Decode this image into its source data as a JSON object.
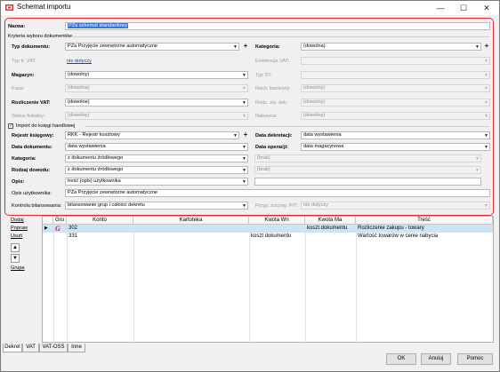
{
  "window": {
    "title": "Schemat importu",
    "icon": "app-icon",
    "controls": {
      "minimize": "—",
      "maximize": "☐",
      "close": "✕"
    }
  },
  "form": {
    "name_label": "Nazwa:",
    "name_value": "PZa schemat standardowy",
    "criteria_heading": "Kryteria wyboru dokumentów",
    "doc_type_label": "Typ dokumentu:",
    "doc_type_value": "PZa Przyjęcie zewnętrzne automatyczne",
    "doc_type_plus": "+",
    "category_label": "Kategoria:",
    "category_value": "(dowolna)",
    "category_plus": "+",
    "typ_ts_label": "Typ tr. VAT:",
    "typ_ts_value": "nie dotyczy",
    "ewidencja_label": "Ewidencja VAT:",
    "ewidencja_value": "",
    "magazyn_label": "Magazyn:",
    "magazyn_value": "(dowolny)",
    "typ_st_label": "Typ ŚT:",
    "typ_st_value": "",
    "kasa_label": "Kasa:",
    "kasa_value": "(dowolna)",
    "rach_label": "Rach. bankowy:",
    "rach_value": "(dowolny)",
    "rozliczenie_label": "Rozliczenie VAT:",
    "rozliczenie_value": "(dowolne)",
    "rodz_zw_label": "Rodz. zw. dek.:",
    "rodz_zw_value": "(dowolny)",
    "status_label": "Status fiskalny:",
    "status_value": "(dowolny)",
    "nabywca_label": "Nabywca:",
    "nabywca_value": "(dowolny)",
    "import_label": "Import do księgi handlowej",
    "import_checked": true,
    "rejestr_label": "Rejestr księgowy:",
    "rejestr_value": "RKK - Rejestr kosztowy",
    "rejestr_plus": "+",
    "data_dek_label": "Data dekretacji:",
    "data_dek_value": "data wystawienia",
    "data_dok_label": "Data dokumentu:",
    "data_dok_value": "data wystawienia",
    "data_op_label": "Data operacji:",
    "data_op_value": "data magazynowa",
    "kategoria2_label": "Kategoria:",
    "kategoria2_value": "z dokumentu źródłowego",
    "kategoria2_right": "(brak)",
    "rodzaj_label": "Rodzaj dowodu:",
    "rodzaj_value": "z dokumentu źródłowego",
    "rodzaj_right": "(brak)",
    "opis_label": "Opis:",
    "opis_value": "treść (opis) użytkownika",
    "opis_uzyt_label": "Opis użytkownika:",
    "opis_uzyt_value": "PZa Przyjęcie zewnętrzne automatyczne",
    "kontrola_label": "Kontrola bilansowania:",
    "kontrola_value": "bilansowanie grup i całości dekretu",
    "przyp_label": "Przyp. szczeg. PIT:",
    "przyp_value": "nie dotyczy"
  },
  "grid": {
    "columns": [
      "Gru",
      "Konto",
      "Kartoteka",
      "Kwota Wn",
      "Kwota Ma",
      "Treść"
    ],
    "rows": [
      {
        "marker": "▶",
        "gru": "G",
        "konto": "302",
        "kartoteka": "",
        "wn": "",
        "ma": "koszt dokumentu",
        "tresc": "Rozliczenie zakupu - towary"
      },
      {
        "marker": "",
        "gru": "",
        "konto": "331",
        "kartoteka": "",
        "wn": "koszt dokumentu",
        "ma": "",
        "tresc": "Wartość towarów w cenie nabycia"
      }
    ]
  },
  "side": {
    "dodaj": "Dodaj",
    "popraw": "Popraw",
    "usun": "Usuń",
    "up": "▲",
    "down": "▼",
    "grupa": "Grupa"
  },
  "tabs": [
    "Dekret",
    "VAT",
    "VAT-OSS",
    "Inne"
  ],
  "buttons": {
    "ok": "OK",
    "anuluj": "Anuluj",
    "pomoc": "Pomoc"
  },
  "colors": {
    "highlight_frame": "#e0282f",
    "row_selected": "#cfe3f7",
    "text_selected": "#3875d7",
    "group_marker": "#c0282f"
  }
}
